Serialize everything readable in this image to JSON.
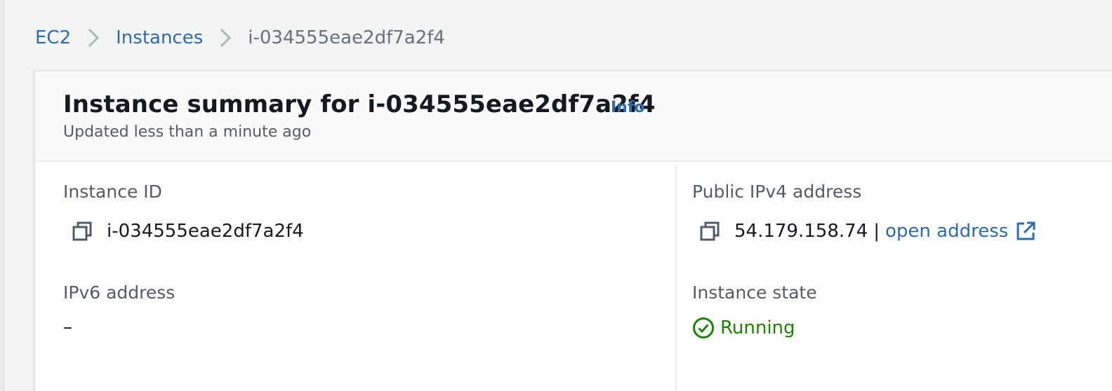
{
  "breadcrumb": {
    "items": [
      {
        "label": "EC2"
      },
      {
        "label": "Instances"
      }
    ],
    "current": "i-034555eae2df7a2f4"
  },
  "summary": {
    "title": "Instance summary for i-034555eae2df7a2f4",
    "info_label": "Info",
    "subtitle": "Updated less than a minute ago"
  },
  "fields": {
    "instance_id": {
      "label": "Instance ID",
      "value": "i-034555eae2df7a2f4"
    },
    "public_ipv4": {
      "label": "Public IPv4 address",
      "value": "54.179.158.74",
      "separator": "|",
      "link_label": "open address"
    },
    "ipv6": {
      "label": "IPv6 address",
      "value": "–"
    },
    "instance_state": {
      "label": "Instance state",
      "value": "Running"
    }
  },
  "icons": {
    "copy": "copy-icon",
    "external": "external-link-icon",
    "status": "check-circle-icon",
    "separator": "chevron-right-icon"
  },
  "colors": {
    "link": "#2f6ba8",
    "success": "#1d8102",
    "label": "#545b64",
    "text": "#16191f",
    "background": "#f2f3f3"
  }
}
